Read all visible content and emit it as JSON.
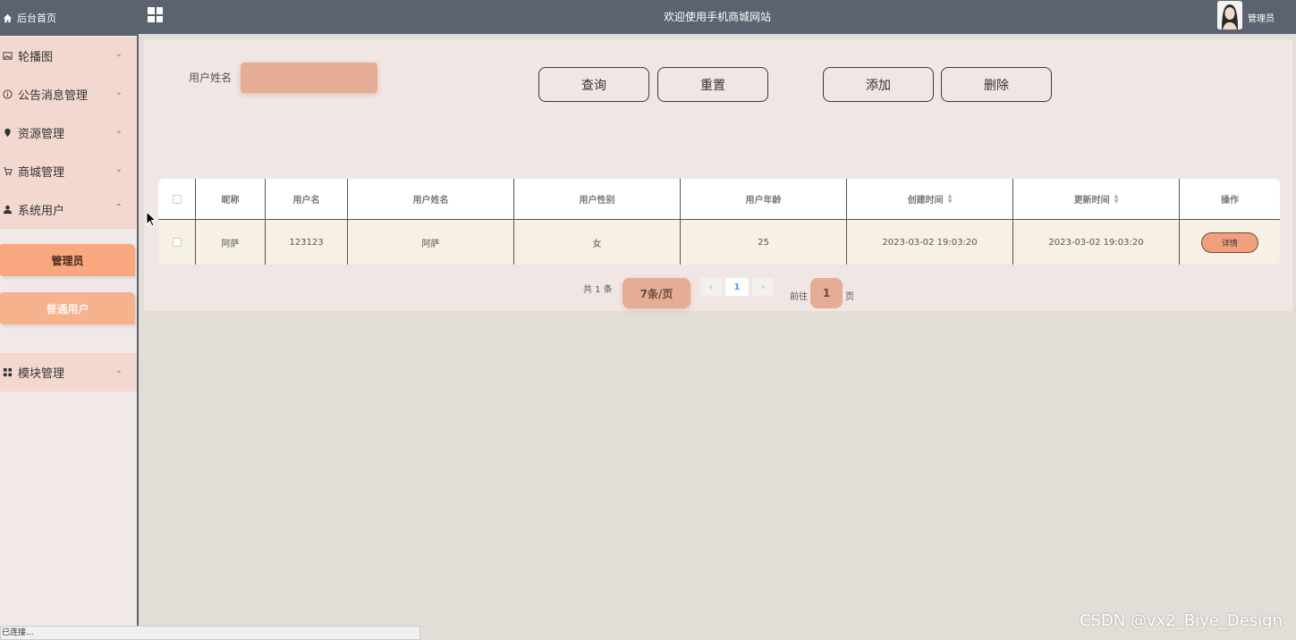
{
  "header": {
    "title": "欢迎使用手机商城网站",
    "user": "管理员"
  },
  "sidebar": {
    "home": "后台首页",
    "items": [
      {
        "label": "轮播图",
        "icon": "image-icon"
      },
      {
        "label": "公告消息管理",
        "icon": "info-icon"
      },
      {
        "label": "资源管理",
        "icon": "location-icon"
      },
      {
        "label": "商城管理",
        "icon": "cart-icon"
      },
      {
        "label": "系统用户",
        "icon": "user-icon",
        "expanded": true
      },
      {
        "label": "模块管理",
        "icon": "grid-icon"
      }
    ],
    "sub_items": [
      "管理员",
      "普通用户"
    ]
  },
  "search": {
    "label": "用户姓名",
    "value": ""
  },
  "buttons": {
    "query": "查询",
    "reset": "重置",
    "add": "添加",
    "delete": "删除"
  },
  "table": {
    "columns": [
      "昵称",
      "用户名",
      "用户姓名",
      "用户性别",
      "用户年龄",
      "创建时间",
      "更新时间",
      "操作"
    ],
    "rows": [
      {
        "nickname": "阿萨",
        "username": "123123",
        "realname": "阿萨",
        "gender": "女",
        "age": "25",
        "created": "2023-03-02 19:03:20",
        "updated": "2023-03-02 19:03:20",
        "action": "详情"
      }
    ]
  },
  "pagination": {
    "total": "共 1 条",
    "page_size": "7条/页",
    "current": "1",
    "goto_label": "前往",
    "goto_value": "1",
    "page_unit": "页"
  },
  "status_bar": "已连接...",
  "watermark": "CSDN @vx2_Biye_Design",
  "colors": {
    "header_bg": "#5c6370",
    "accent": "#f8a77e",
    "menu_bg": "#f3d8d0",
    "panel_bg": "#f0e6e3"
  }
}
